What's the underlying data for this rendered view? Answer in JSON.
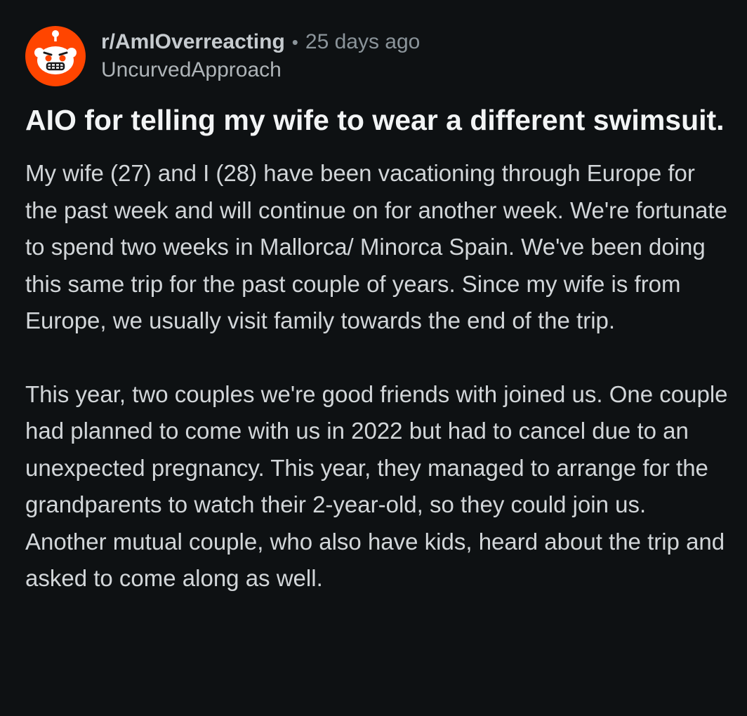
{
  "post": {
    "subreddit": "r/AmIOverreacting",
    "separator": "•",
    "time_ago": "25 days ago",
    "author": "UncurvedApproach",
    "title": "AIO for telling my wife to wear a different swimsuit.",
    "paragraphs": [
      "My wife (27) and I (28) have been vacationing through Europe for the past week and will continue on for another week. We're fortunate to spend two weeks in Mallorca/ Minorca Spain. We've been doing this same trip for the past couple of years. Since my wife is from Europe, we usually visit family towards the end of the trip.",
      "This year, two couples we're good friends with joined us. One couple had planned to come with us in 2022 but had to cancel due to an unexpected pregnancy. This year, they managed to arrange for the grandparents to watch their 2-year-old, so they could join us. Another mutual couple, who also have kids, heard about the trip and asked to come along as well."
    ]
  },
  "icons": {
    "avatar": "snoo-subreddit-icon"
  },
  "colors": {
    "background": "#0e1113",
    "avatar_orange": "#ff4500",
    "title_text": "#f2f4f5",
    "body_text": "#d2d6d9",
    "meta_text": "#8b949a"
  }
}
